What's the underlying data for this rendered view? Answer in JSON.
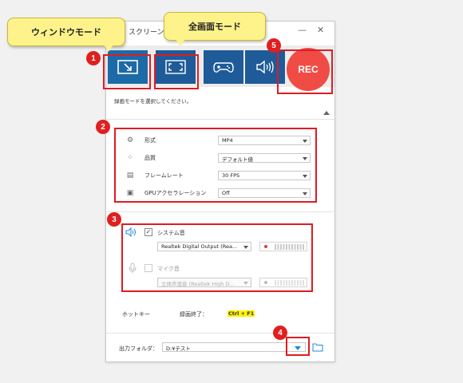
{
  "window": {
    "title": "スクリーン",
    "minimize": "—",
    "close": "✕"
  },
  "toolbar": {
    "buttons": [
      {
        "name": "window-mode",
        "icon": "window-mode-icon"
      },
      {
        "name": "fullscreen-mode",
        "icon": "fullscreen-icon"
      },
      {
        "name": "game-mode",
        "icon": "gamepad-icon"
      },
      {
        "name": "audio-mode",
        "icon": "speaker-icon"
      }
    ],
    "rec_label": "REC"
  },
  "hint_text": "録画モードを選択してください。",
  "settings": {
    "format": {
      "label": "形式",
      "value": "MP4"
    },
    "quality": {
      "label": "品質",
      "value": "デフォルト値"
    },
    "framerate": {
      "label": "フレームレート",
      "value": "30 FPS"
    },
    "gpu": {
      "label": "GPUアクセラレーション",
      "value": "Off"
    }
  },
  "audio": {
    "system": {
      "label": "システム音",
      "checked": true,
      "device": "Realtek Digital Output (Rea..."
    },
    "mic": {
      "label": "マイク音",
      "checked": false,
      "device": "立体声混音 (Realtek High D..."
    }
  },
  "hotkey": {
    "label": "ホットキー",
    "action": "録画終了：",
    "keys": "Ctrl + F1"
  },
  "output": {
    "label": "出力フォルダ：",
    "path": "D:¥テスト"
  },
  "annotations": {
    "callout_window": "ウィンドウモード",
    "callout_fullscreen": "全画面モード",
    "badges": [
      "1",
      "2",
      "3",
      "4",
      "5"
    ]
  },
  "colors": {
    "accent": "#1e5b98",
    "rec": "#f04c45",
    "annotation_red": "#e01b22",
    "callout": "#fdf38a"
  }
}
